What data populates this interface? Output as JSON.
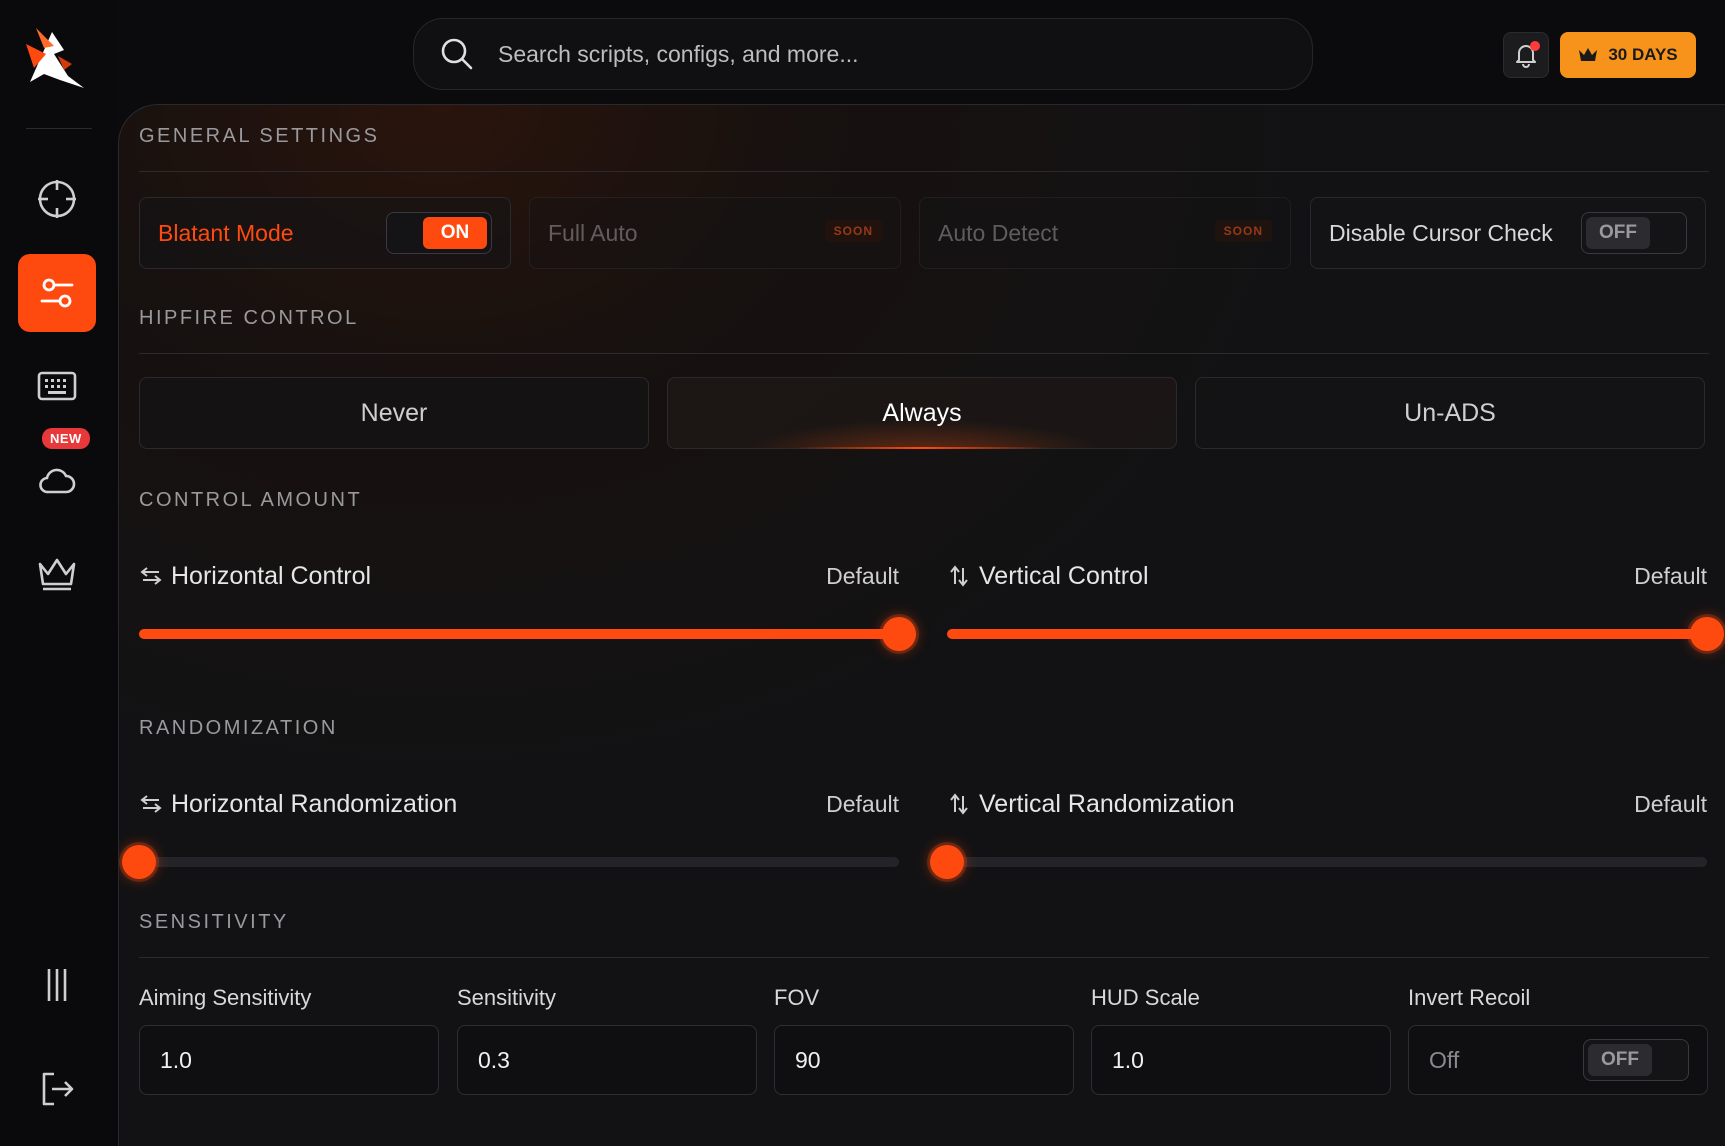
{
  "search": {
    "placeholder": "Search scripts, configs, and more..."
  },
  "topbar": {
    "days_label": "30 DAYS"
  },
  "sidebar": {
    "new_badge": "NEW"
  },
  "general": {
    "title": "GENERAL SETTINGS",
    "blatant": {
      "label": "Blatant Mode",
      "state": "ON"
    },
    "full_auto": {
      "label": "Full Auto",
      "badge": "SOON"
    },
    "auto_detect": {
      "label": "Auto Detect",
      "badge": "SOON"
    },
    "cursor_check": {
      "label": "Disable Cursor Check",
      "state": "OFF"
    }
  },
  "hipfire": {
    "title": "HIPFIRE CONTROL",
    "options": [
      "Never",
      "Always",
      "Un-ADS"
    ],
    "selected": "Always"
  },
  "control": {
    "title": "CONTROL AMOUNT",
    "horizontal": {
      "label": "Horizontal Control",
      "preset": "Default",
      "value": 1.0
    },
    "vertical": {
      "label": "Vertical Control",
      "preset": "Default",
      "value": 1.0
    }
  },
  "randomization": {
    "title": "RANDOMIZATION",
    "horizontal": {
      "label": "Horizontal Randomization",
      "preset": "Default",
      "value": 0.0
    },
    "vertical": {
      "label": "Vertical Randomization",
      "preset": "Default",
      "value": 0.0
    }
  },
  "sensitivity": {
    "title": "SENSITIVITY",
    "aiming": {
      "label": "Aiming Sensitivity",
      "value": "1.0"
    },
    "sensitivity": {
      "label": "Sensitivity",
      "value": "0.3"
    },
    "fov": {
      "label": "FOV",
      "value": "90"
    },
    "hud": {
      "label": "HUD Scale",
      "value": "1.0"
    },
    "invert": {
      "label": "Invert Recoil",
      "value": "Off",
      "state": "OFF"
    }
  },
  "colors": {
    "accent": "#ff4a0f",
    "gold": "#f7931a",
    "soon": "#ff5a1a"
  },
  "icons": {
    "logo": "brand-logo-icon",
    "nav": [
      "crosshair-icon",
      "sliders-icon",
      "keyboard-icon",
      "cloud-icon",
      "crown-icon",
      "menu-bars-icon",
      "logout-icon"
    ]
  }
}
